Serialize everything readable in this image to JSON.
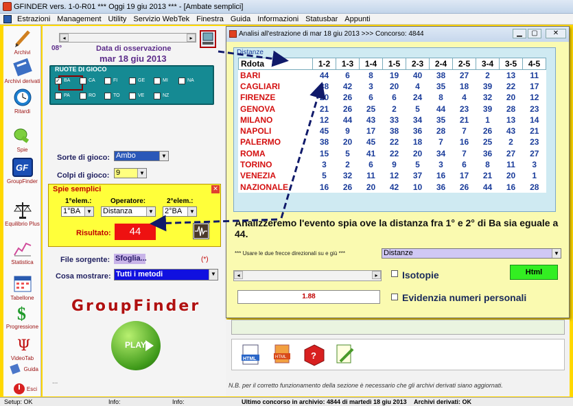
{
  "window": {
    "title": "GFINDER vers.  1-0-R01  ***  Oggi 19 giu 2013  ***  - [Ambate semplici]"
  },
  "menu": [
    "Estrazioni",
    "Management",
    "Utility",
    "Servizio WebTek",
    "Finestra",
    "Guida",
    "Informazioni",
    "Statusbar",
    "Appunti"
  ],
  "sidebar": [
    {
      "label": "Archivi",
      "icon": "pencil-icon"
    },
    {
      "label": "Archivi derivati",
      "icon": "book-icon"
    },
    {
      "label": "Ritardi",
      "icon": "clock-icon"
    },
    {
      "label": "Spie",
      "icon": "flashlight-icon"
    },
    {
      "label": "GroupFinder",
      "icon": "gf-logo-icon"
    },
    {
      "label": "Equilibrio Plus",
      "icon": "scales-icon"
    },
    {
      "label": "Statistica",
      "icon": "chart-icon"
    },
    {
      "label": "Tabellone",
      "icon": "calendar-icon"
    },
    {
      "label": "Progressione",
      "icon": "dollar-icon"
    },
    {
      "label": "VideoTab",
      "icon": "psi-icon"
    },
    {
      "label": "Guida",
      "icon": "guide-icon"
    },
    {
      "label": "Esci",
      "icon": "exit-icon"
    }
  ],
  "main": {
    "week": "08°",
    "obs_title": "Data di osservazione",
    "obs_date": "mar 18 giu 2013",
    "ruote_title": "RUOTE DI GIOCO",
    "ruote": [
      {
        "code": "BA",
        "checked": true
      },
      {
        "code": "CA",
        "checked": false
      },
      {
        "code": "FI",
        "checked": false
      },
      {
        "code": "GE",
        "checked": false
      },
      {
        "code": "MI",
        "checked": false
      },
      {
        "code": "NA",
        "checked": false
      },
      {
        "code": "PA",
        "checked": false
      },
      {
        "code": "RO",
        "checked": false
      },
      {
        "code": "TO",
        "checked": false
      },
      {
        "code": "VE",
        "checked": false
      },
      {
        "code": "NZ",
        "checked": false
      }
    ],
    "sorte_label": "Sorte di gioco:",
    "sorte_value": "Ambo",
    "colpi_label": "Colpi di gioco:",
    "colpi_value": "9",
    "spie_title": "Spie semplici",
    "el1_label": "1°elem.:",
    "op_label": "Operatore:",
    "el2_label": "2°elem.:",
    "el1_value": "1°BA",
    "op_value": "Distanza",
    "el2_value": "2°BA",
    "risultato_label": "Risultato:",
    "risultato_value": "44",
    "file_label": "File sorgente:",
    "file_button": "Sfoglia...",
    "file_mark": "(*)",
    "cosa_label": "Cosa mostrare:",
    "cosa_value": "Tutti i metodi",
    "logo_text": "GroupFinder",
    "play_label": "PLAY",
    "dots": "..."
  },
  "analysis": {
    "title": "Analisi all'estrazione di mar 18 giu 2013 >>> Concorso: 4844",
    "frame_title": "Distanze",
    "columns": [
      "Rdota",
      "1-2",
      "1-3",
      "1-4",
      "1-5",
      "2-3",
      "2-4",
      "2-5",
      "3-4",
      "3-5",
      "4-5"
    ],
    "rows": [
      [
        "BARI",
        "44",
        "6",
        "8",
        "19",
        "40",
        "38",
        "27",
        "2",
        "13",
        "11"
      ],
      [
        "CAGLIARI",
        "38",
        "42",
        "3",
        "20",
        "4",
        "35",
        "18",
        "39",
        "22",
        "17"
      ],
      [
        "FIRENZE",
        "20",
        "26",
        "6",
        "6",
        "24",
        "8",
        "4",
        "32",
        "20",
        "12"
      ],
      [
        "GENOVA",
        "21",
        "26",
        "25",
        "2",
        "5",
        "44",
        "23",
        "39",
        "28",
        "23"
      ],
      [
        "MILANO",
        "12",
        "44",
        "43",
        "33",
        "34",
        "35",
        "21",
        "1",
        "13",
        "14"
      ],
      [
        "NAPOLI",
        "45",
        "9",
        "17",
        "38",
        "36",
        "28",
        "7",
        "26",
        "43",
        "21"
      ],
      [
        "PALERMO",
        "38",
        "20",
        "45",
        "22",
        "18",
        "7",
        "16",
        "25",
        "2",
        "23"
      ],
      [
        "ROMA",
        "15",
        "5",
        "41",
        "22",
        "20",
        "34",
        "7",
        "36",
        "27",
        "27"
      ],
      [
        "TORINO",
        "3",
        "2",
        "6",
        "9",
        "5",
        "3",
        "6",
        "8",
        "11",
        "3"
      ],
      [
        "VENEZIA",
        "5",
        "32",
        "11",
        "12",
        "37",
        "16",
        "17",
        "21",
        "20",
        "1"
      ],
      [
        "NAZIONALE",
        "16",
        "26",
        "20",
        "42",
        "10",
        "36",
        "26",
        "44",
        "16",
        "28"
      ]
    ],
    "annotation": "Analizzeremo l'evento spia ove la distanza fra 1° e 2° di Ba sia eguale a 44.",
    "arrows_label": "*** Usare le due frecce direzionali su e giù ***",
    "arrows_value": "Distanze",
    "isotopie_label": "Isotopie",
    "html_button": "Html",
    "value_box": "1.88",
    "evidenzia_label": "Evidenzia numeri personali"
  },
  "lower": {
    "note": "N.B. per il corretto funzionamento della sezione è necessario che gli archivi derivati siano aggiornati."
  },
  "status": {
    "setup": "Setup: OK",
    "info1": "Info:",
    "info2": "Info:",
    "ultimo": "Ultimo concorso in archivio: 4844 di martedì 18 giu 2013",
    "derivati": "Archivi derivati: OK"
  }
}
